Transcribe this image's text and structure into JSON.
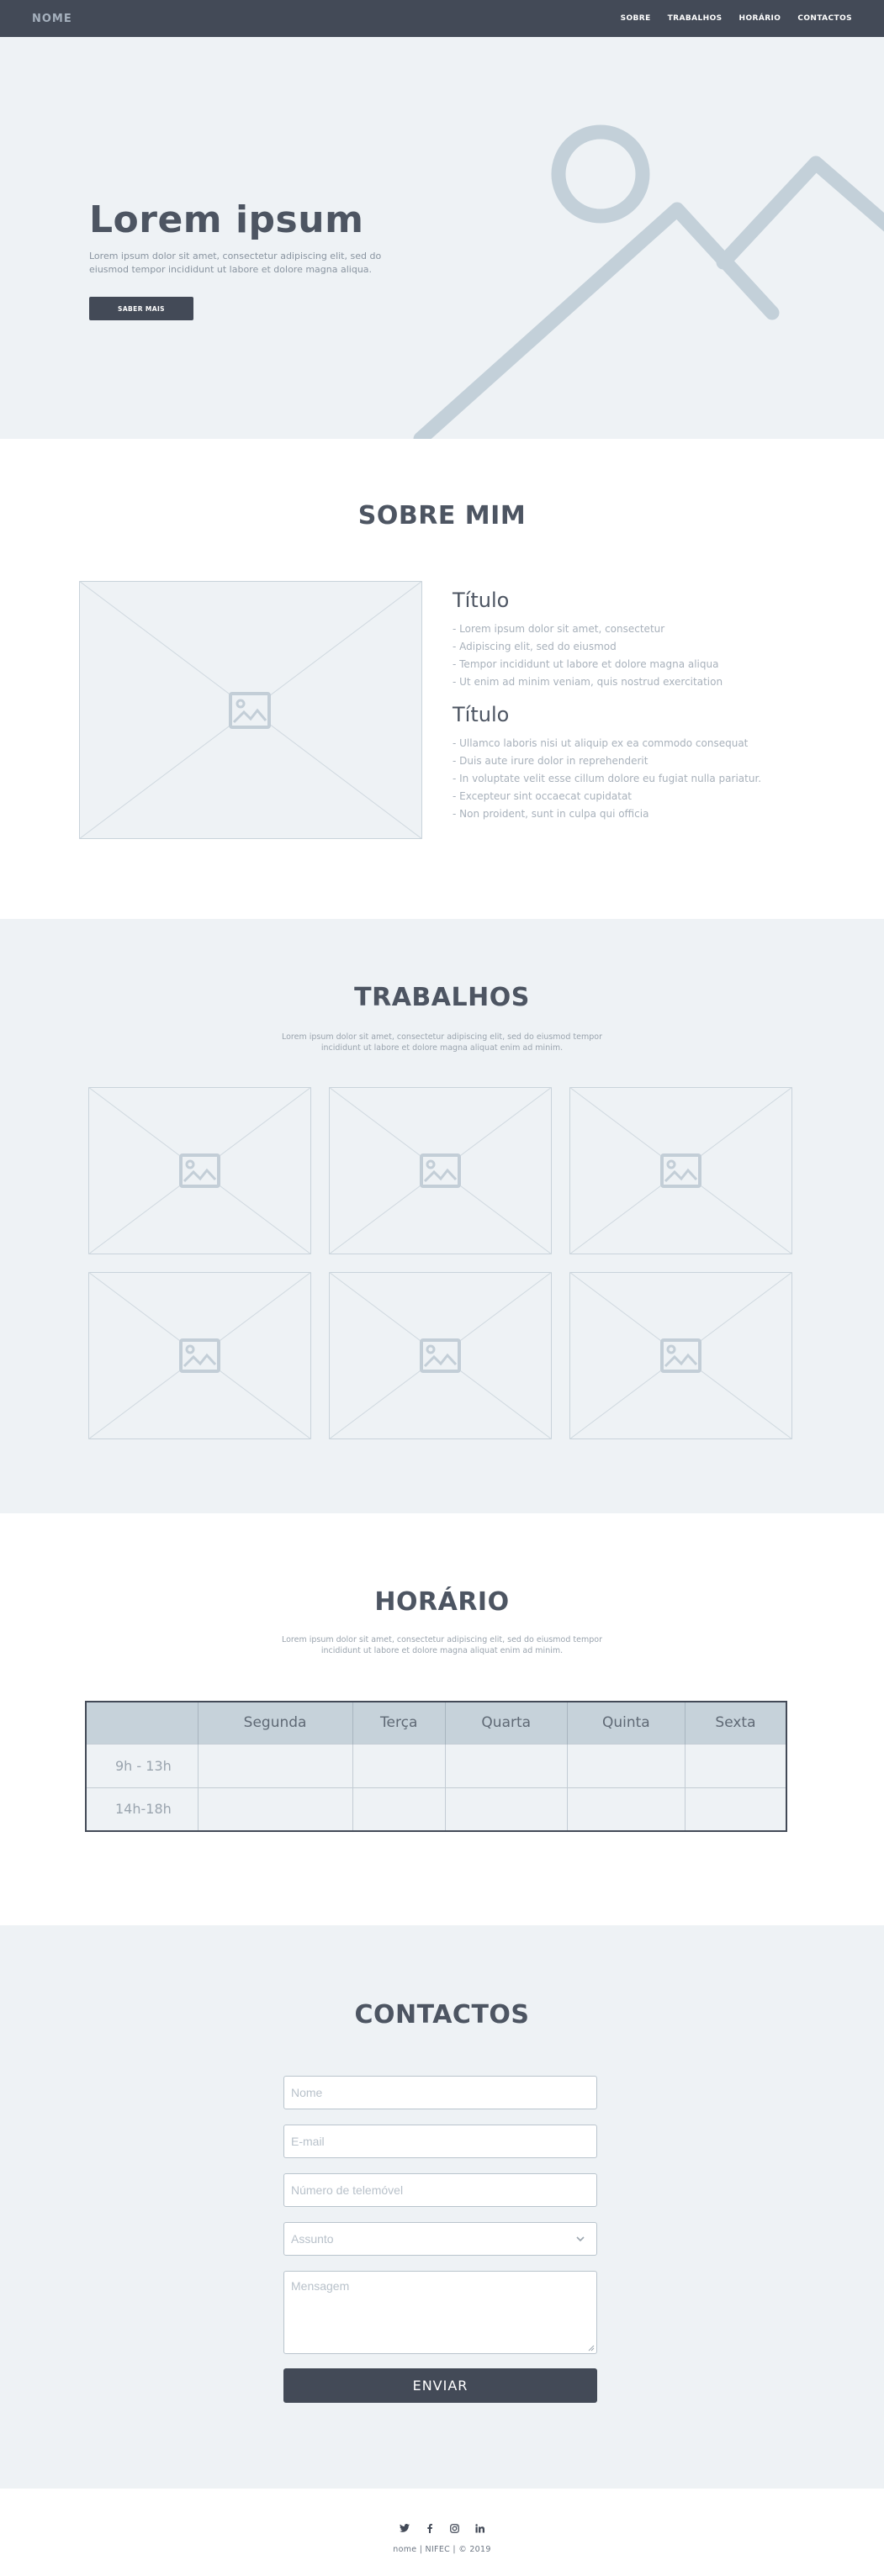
{
  "nav": {
    "brand": "NOME",
    "links": [
      "SOBRE",
      "TRABALHOS",
      "HORÁRIO",
      "CONTACTOS"
    ]
  },
  "hero": {
    "title": "Lorem ipsum",
    "text": "Lorem ipsum dolor sit amet, consectetur adipiscing elit, sed do eiusmod tempor incididunt ut labore et dolore magna aliqua.",
    "button": "SABER MAIS"
  },
  "about": {
    "title": "SOBRE MIM",
    "blocks": [
      {
        "heading": "Título",
        "items": [
          "- Lorem ipsum dolor sit amet, consectetur",
          "- Adipiscing elit, sed do eiusmod",
          "- Tempor incididunt ut labore et dolore magna aliqua",
          "- Ut enim ad minim veniam, quis nostrud exercitation"
        ]
      },
      {
        "heading": "Título",
        "items": [
          "- Ullamco laboris nisi ut aliquip ex ea commodo consequat",
          "- Duis aute irure dolor in reprehenderit",
          "- In voluptate velit esse cillum dolore eu fugiat nulla pariatur.",
          "- Excepteur sint occaecat cupidatat",
          "- Non proident, sunt in culpa qui officia"
        ]
      }
    ]
  },
  "works": {
    "title": "TRABALHOS",
    "subtitle": "Lorem ipsum dolor sit amet, consectetur adipiscing elit, sed do eiusmod tempor incididunt ut labore et dolore magna aliquat enim ad minim.",
    "count": 6
  },
  "schedule": {
    "title": "HORÁRIO",
    "subtitle": "Lorem ipsum dolor sit amet, consectetur adipiscing elit, sed do eiusmod tempor incididunt ut labore et dolore magna aliquat enim ad minim.",
    "days": [
      "Segunda",
      "Terça",
      "Quarta",
      "Quinta",
      "Sexta"
    ],
    "rows": [
      "9h - 13h",
      "14h-18h"
    ]
  },
  "contacts": {
    "title": "CONTACTOS",
    "name_placeholder": "Nome",
    "email_placeholder": "E-mail",
    "phone_placeholder": "Número de telemóvel",
    "subject_placeholder": "Assunto",
    "message_placeholder": "Mensagem",
    "submit": "ENVIAR"
  },
  "footer": {
    "socials": [
      "twitter-icon",
      "facebook-icon",
      "instagram-icon",
      "linkedin-icon"
    ],
    "text": "nome | NIFEC | © 2019"
  },
  "colors": {
    "dark": "#434a57",
    "light_bg": "#eef2f5",
    "placeholder_line": "#c6d2da"
  }
}
